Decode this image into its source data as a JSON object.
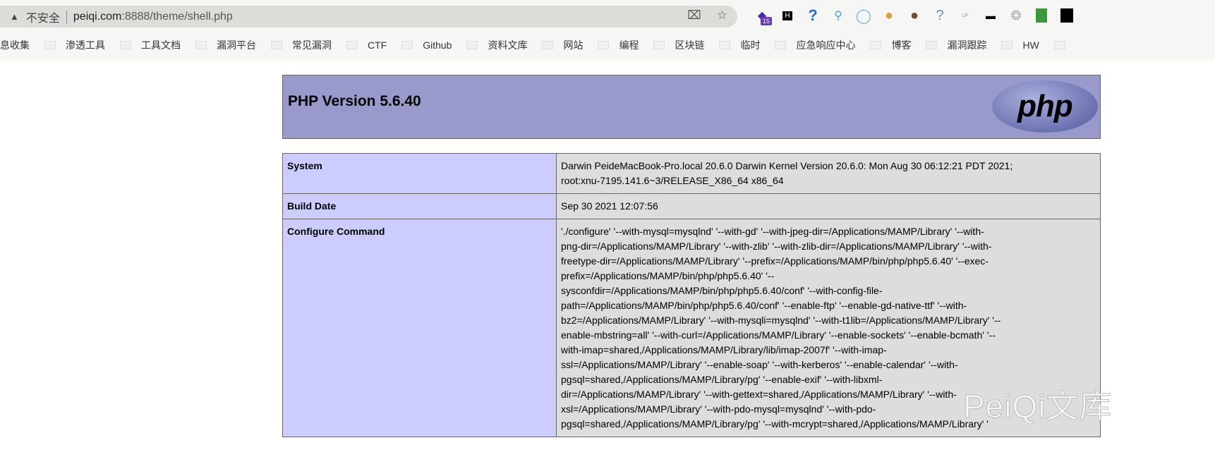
{
  "browser": {
    "security_label": "不安全",
    "url_host": "peiqi.com",
    "url_rest": ":8888/theme/shell.php",
    "extension_badge": "15",
    "bookmarks": [
      "息收集",
      "渗透工具",
      "工具文档",
      "漏洞平台",
      "常见漏洞",
      "CTF",
      "Github",
      "资料文库",
      "网站",
      "编程",
      "区块链",
      "临时",
      "应急响应中心",
      "博客",
      "漏洞跟踪",
      "HW"
    ]
  },
  "page": {
    "title": "PHP Version 5.6.40",
    "logo_text": "php",
    "rows": [
      {
        "label": "System",
        "lines": [
          "Darwin PeideMacBook-Pro.local 20.6.0 Darwin Kernel Version 20.6.0: Mon Aug 30 06:12:21 PDT 2021;",
          "root:xnu-7195.141.6~3/RELEASE_X86_64 x86_64"
        ]
      },
      {
        "label": "Build Date",
        "lines": [
          "Sep 30 2021 12:07:56"
        ]
      },
      {
        "label": "Configure Command",
        "lines": [
          "'./configure' '--with-mysql=mysqlnd' '--with-gd' '--with-jpeg-dir=/Applications/MAMP/Library' '--with-",
          "png-dir=/Applications/MAMP/Library' '--with-zlib' '--with-zlib-dir=/Applications/MAMP/Library' '--with-",
          "freetype-dir=/Applications/MAMP/Library' '--prefix=/Applications/MAMP/bin/php/php5.6.40' '--exec-",
          "prefix=/Applications/MAMP/bin/php/php5.6.40' '--",
          "sysconfdir=/Applications/MAMP/bin/php/php5.6.40/conf' '--with-config-file-",
          "path=/Applications/MAMP/bin/php/php5.6.40/conf' '--enable-ftp' '--enable-gd-native-ttf' '--with-",
          "bz2=/Applications/MAMP/Library' '--with-mysqli=mysqlnd' '--with-t1lib=/Applications/MAMP/Library' '--",
          "enable-mbstring=all' '--with-curl=/Applications/MAMP/Library' '--enable-sockets' '--enable-bcmath' '--",
          "with-imap=shared,/Applications/MAMP/Library/lib/imap-2007f' '--with-imap-",
          "ssl=/Applications/MAMP/Library' '--enable-soap' '--with-kerberos' '--enable-calendar' '--with-",
          "pgsql=shared,/Applications/MAMP/Library/pg' '--enable-exif' '--with-libxml-",
          "dir=/Applications/MAMP/Library' '--with-gettext=shared,/Applications/MAMP/Library' '--with-",
          "xsl=/Applications/MAMP/Library' '--with-pdo-mysql=mysqlnd' '--with-pdo-",
          "pgsql=shared,/Applications/MAMP/Library/pg' '--with-mcrypt=shared,/Applications/MAMP/Library' '"
        ]
      }
    ]
  },
  "watermark": "PeiQi文库",
  "colors": {
    "header_bg": "#9999cc",
    "label_bg": "#ccccff",
    "value_bg": "#dddddd"
  }
}
